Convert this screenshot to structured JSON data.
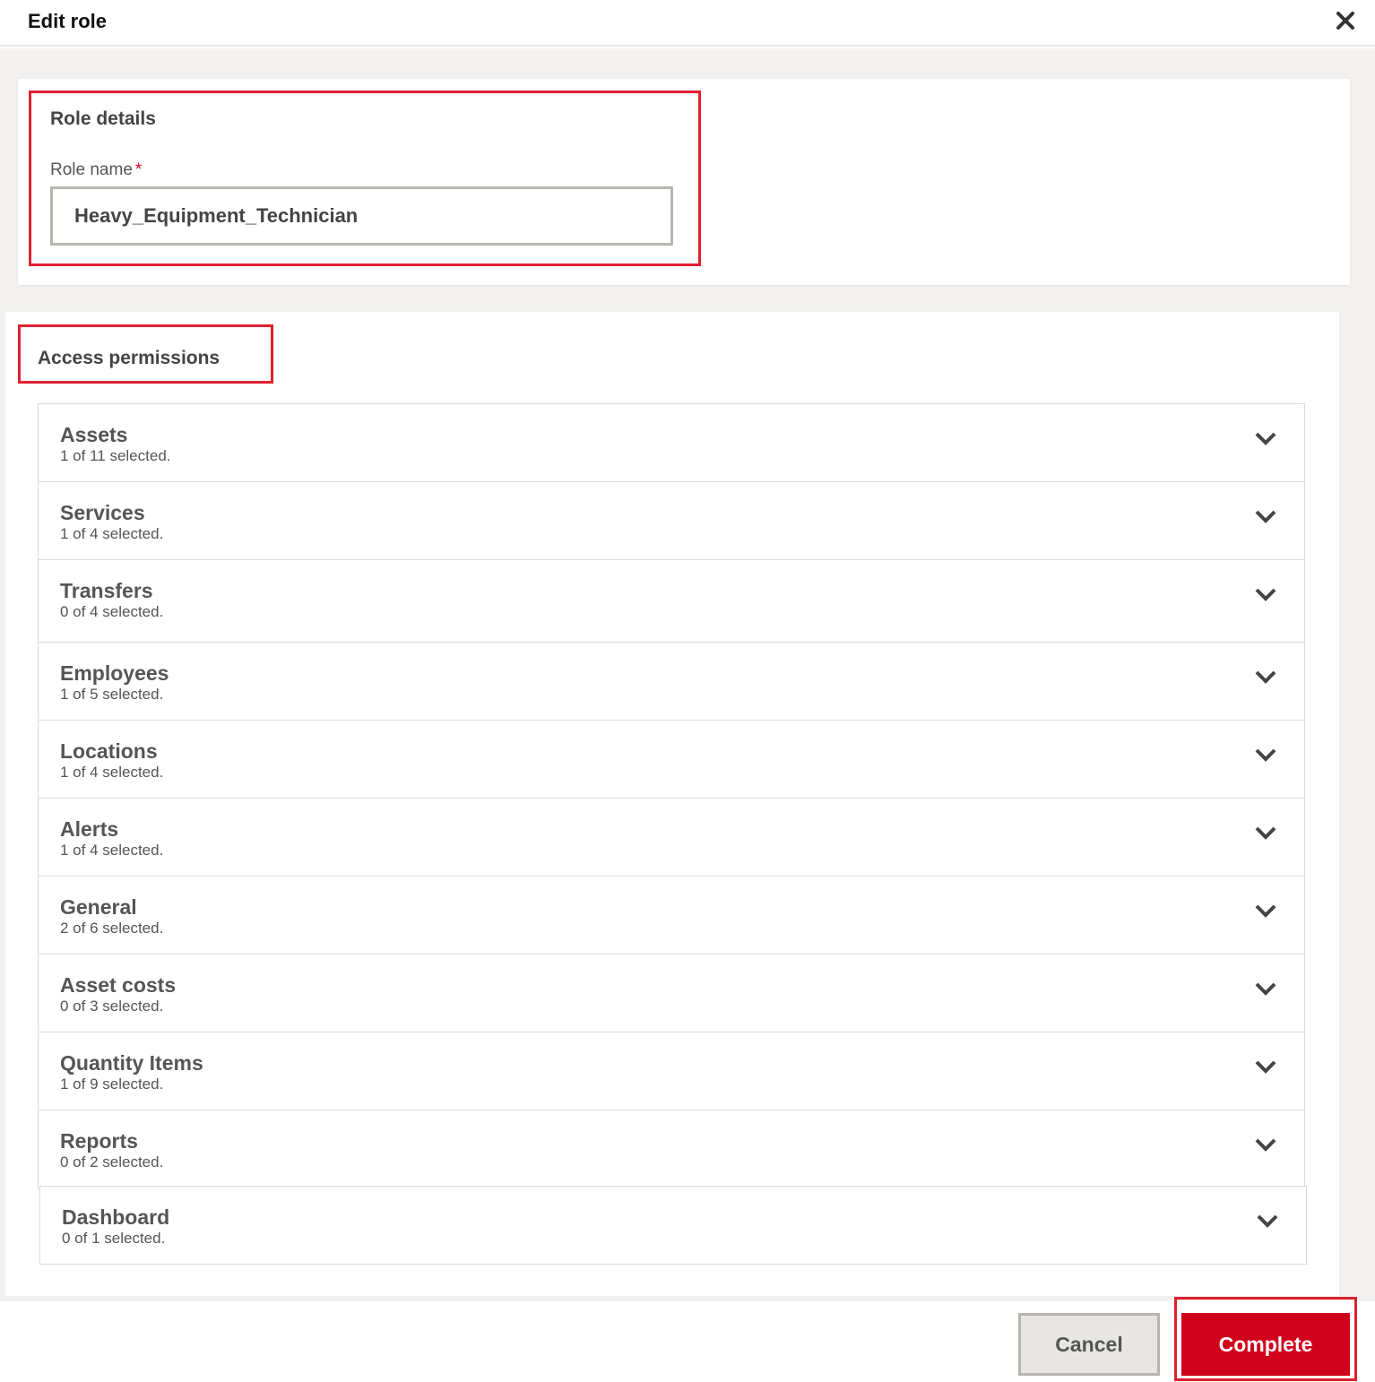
{
  "dialog": {
    "title": "Edit role",
    "close_icon": "close-icon"
  },
  "role_details": {
    "section_title": "Role details",
    "field_label": "Role name",
    "required_marker": "*",
    "role_name_value": "Heavy_Equipment_Technician"
  },
  "access_permissions": {
    "section_title": "Access permissions",
    "chevron_icon": "chevron-down-icon",
    "items": [
      {
        "name": "Assets",
        "count": "1 of 11 selected."
      },
      {
        "name": "Services",
        "count": "1 of 4 selected."
      },
      {
        "name": "Transfers",
        "count": "0 of 4 selected."
      },
      {
        "name": "Employees",
        "count": "1 of 5 selected."
      },
      {
        "name": "Locations",
        "count": "1 of 4 selected."
      },
      {
        "name": "Alerts",
        "count": "1 of 4 selected."
      },
      {
        "name": "General",
        "count": "2 of 6 selected."
      },
      {
        "name": "Asset costs",
        "count": "0 of 3 selected."
      },
      {
        "name": "Quantity Items",
        "count": "1 of 9 selected."
      },
      {
        "name": "Reports",
        "count": "0 of 2 selected."
      },
      {
        "name": "Dashboard",
        "count": "0 of 1 selected."
      }
    ]
  },
  "footer": {
    "cancel_label": "Cancel",
    "complete_label": "Complete"
  },
  "colors": {
    "accent_red": "#d0021b",
    "highlight_red": "#e0202e",
    "panel_bg": "#f2f1ef"
  }
}
